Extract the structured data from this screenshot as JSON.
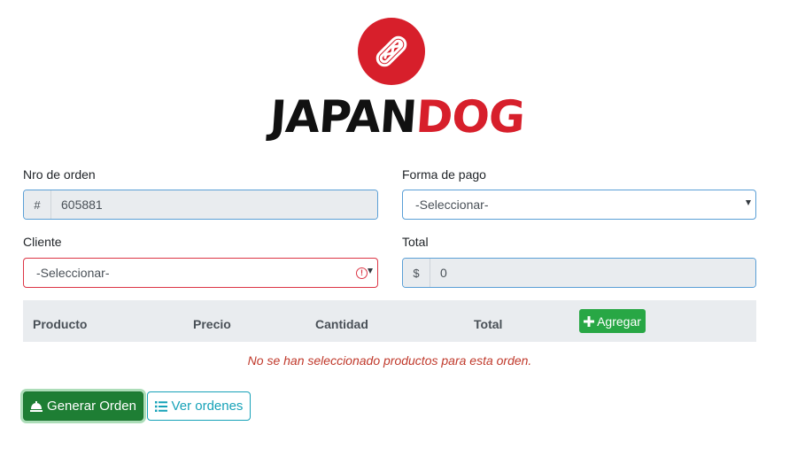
{
  "brand": {
    "name_part1": "JAPAN",
    "name_part2": "DOG",
    "accent_color": "#d71f2b",
    "logo_icon": "hotdog-icon"
  },
  "form": {
    "order_number": {
      "label": "Nro de orden",
      "prefix": "#",
      "value": "605881"
    },
    "payment": {
      "label": "Forma de pago",
      "selected": "-Seleccionar-"
    },
    "client": {
      "label": "Cliente",
      "selected": "-Seleccionar-",
      "state": "invalid"
    },
    "total": {
      "label": "Total",
      "prefix": "$",
      "value": "0"
    }
  },
  "products_table": {
    "columns": [
      "Producto",
      "Precio",
      "Cantidad",
      "Total"
    ],
    "add_button": {
      "label": "Agregar",
      "icon": "plus-icon"
    },
    "rows": [],
    "empty_message": "No se han seleccionado productos para esta orden."
  },
  "actions": {
    "generate": {
      "label": "Generar Orden",
      "icon": "bell-icon",
      "color": "#1e7e34"
    },
    "view_orders": {
      "label": "Ver ordenes",
      "icon": "list-icon",
      "color": "#17a2b8"
    }
  }
}
